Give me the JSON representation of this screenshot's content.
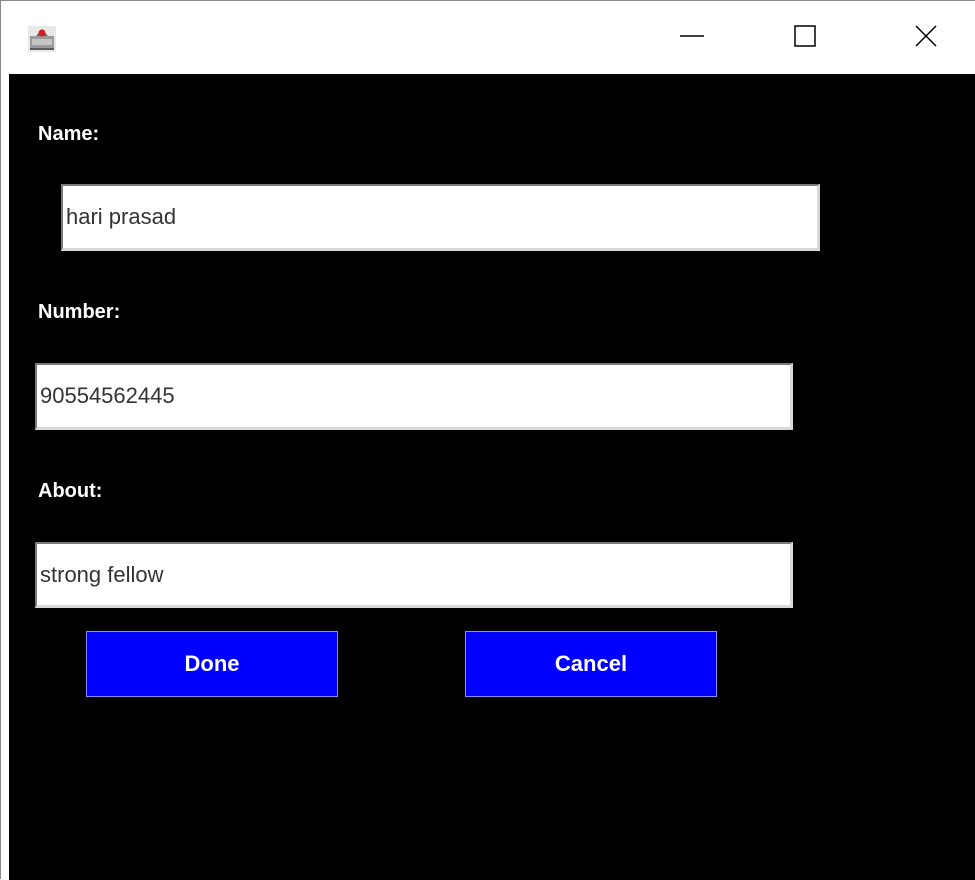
{
  "window": {
    "icon": "java-app-icon",
    "controls": {
      "minimize_icon": "minimize-icon",
      "maximize_icon": "maximize-icon",
      "close_icon": "close-icon"
    }
  },
  "form": {
    "name_label": "Name:",
    "name_value": "hari prasad",
    "number_label": "Number:",
    "number_value": "90554562445",
    "about_label": "About:",
    "about_value": "strong fellow",
    "done_label": "Done",
    "cancel_label": "Cancel"
  },
  "colors": {
    "background": "#000000",
    "button": "#0000ff",
    "button_text": "#ffffff",
    "label_text": "#ffffff"
  }
}
